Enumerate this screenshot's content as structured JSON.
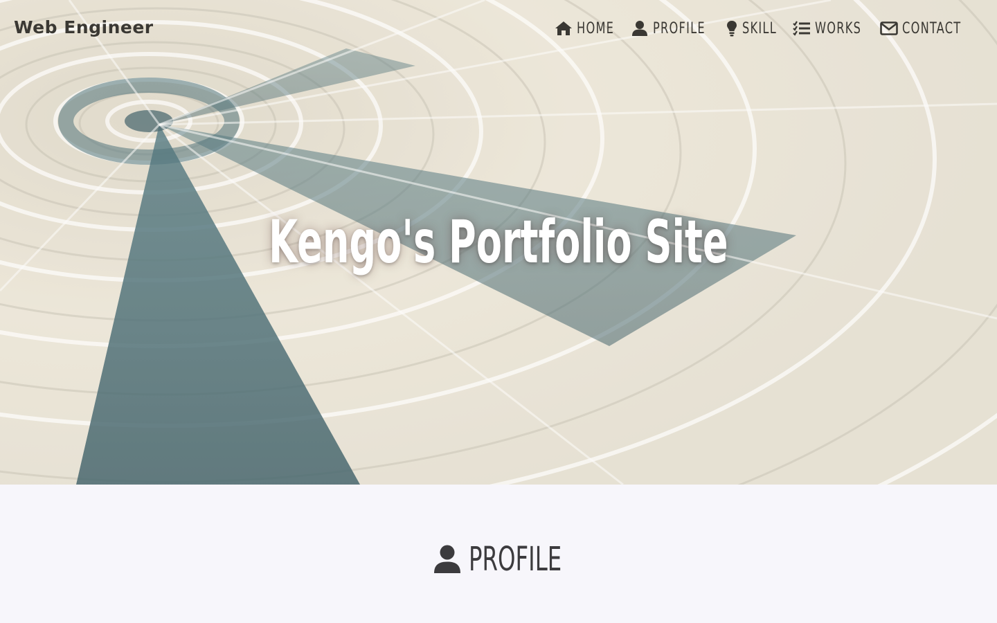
{
  "header": {
    "brand": "Web Engineer",
    "nav": [
      {
        "label": "HOME",
        "icon": "home-icon"
      },
      {
        "label": "PROFILE",
        "icon": "user-icon"
      },
      {
        "label": "SKILL",
        "icon": "lightbulb-icon"
      },
      {
        "label": "WORKS",
        "icon": "list-check-icon"
      },
      {
        "label": "CONTACT",
        "icon": "envelope-icon"
      }
    ]
  },
  "hero": {
    "title": "Kengo's Portfolio Site",
    "background": "abstract-folded-paper-spiral-image"
  },
  "profile_section": {
    "title": "PROFILE",
    "icon": "user-icon"
  },
  "colors": {
    "nav_text": "#3a3833",
    "hero_title": "#ffffff",
    "page_background": "#f7f6fb",
    "heading_text": "#3c3b3e",
    "image_teal": "#2f5b66",
    "image_cream": "#ece6d8"
  }
}
